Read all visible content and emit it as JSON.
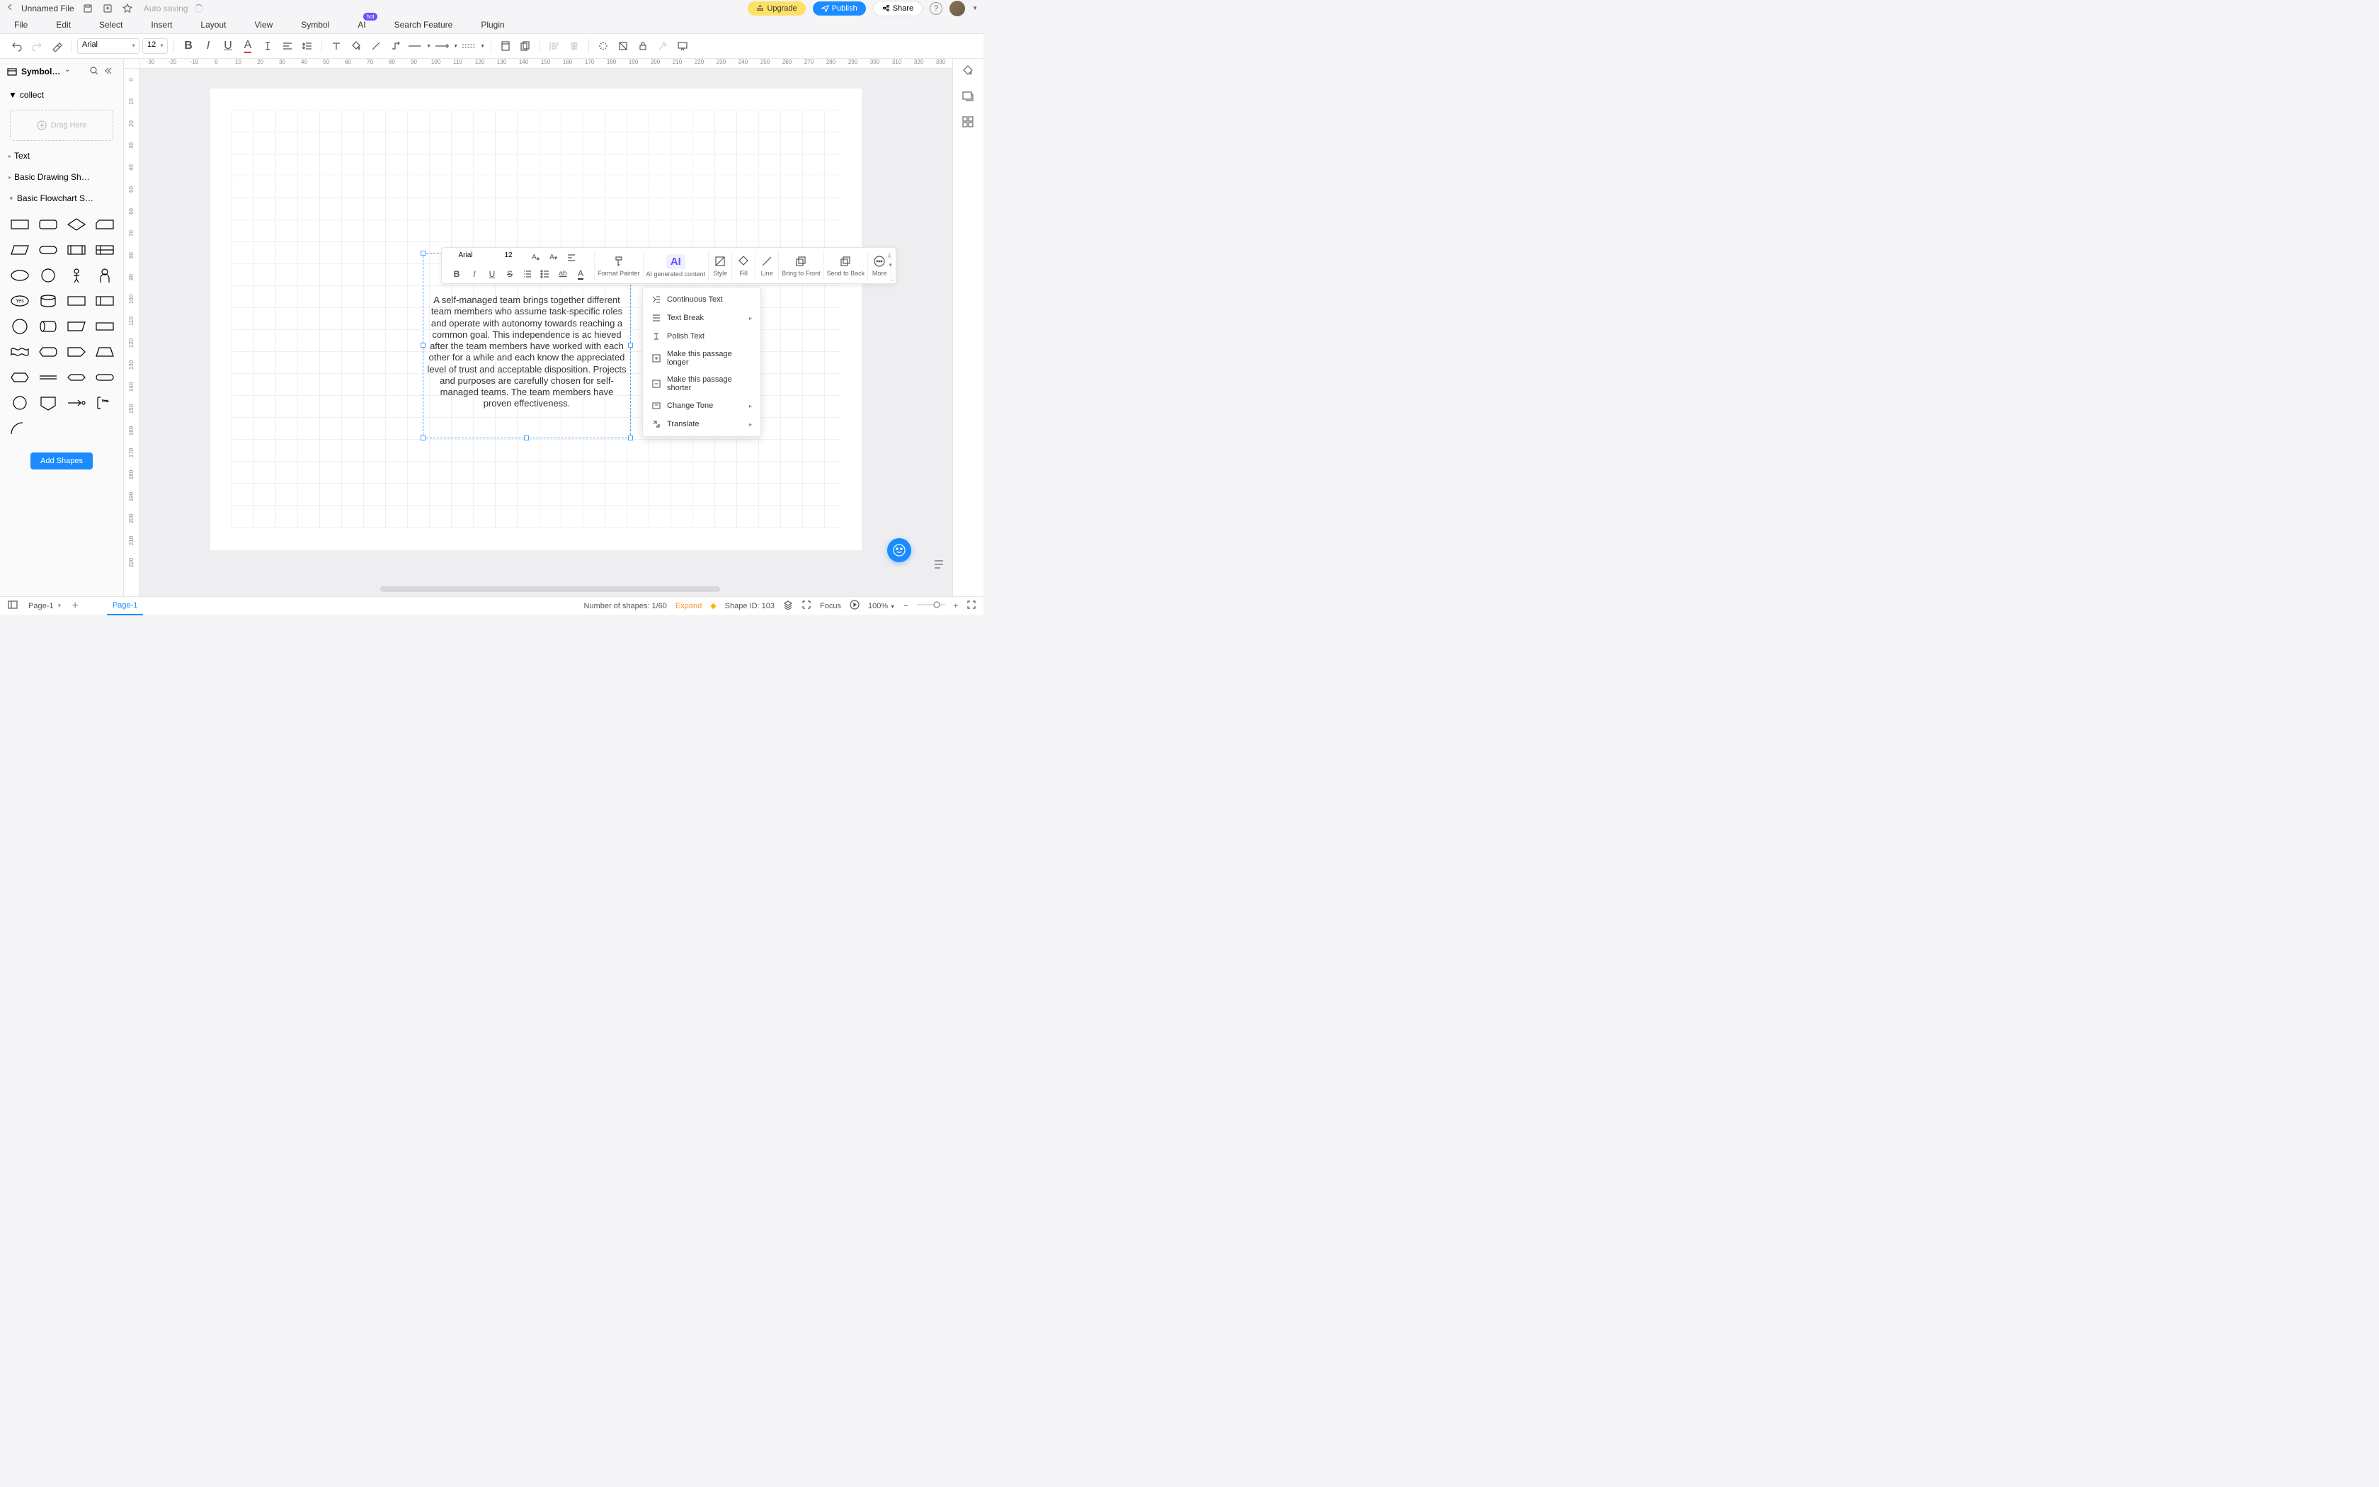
{
  "title": {
    "filename": "Unnamed File",
    "autosave": "Auto saving"
  },
  "topbar": {
    "upgrade": "Upgrade",
    "publish": "Publish",
    "share": "Share"
  },
  "menu": [
    "File",
    "Edit",
    "Select",
    "Insert",
    "Layout",
    "View",
    "Symbol",
    "AI",
    "Search Feature",
    "Plugin"
  ],
  "menu_hot_index": 7,
  "toolbar": {
    "font": "Arial",
    "size": "12"
  },
  "sidebar": {
    "title": "Symbol…",
    "collect": "collect",
    "drag": "Drag Here",
    "cats": [
      "Text",
      "Basic Drawing Sh…",
      "Basic Flowchart S…"
    ],
    "add": "Add Shapes",
    "yes": "Yes"
  },
  "ruler_h": [
    "-30",
    "-20",
    "-10",
    "0",
    "10",
    "20",
    "30",
    "40",
    "50",
    "60",
    "70",
    "80",
    "90",
    "100",
    "110",
    "120",
    "130",
    "140",
    "150",
    "160",
    "170",
    "180",
    "190",
    "200",
    "210",
    "220",
    "230",
    "240",
    "250",
    "260",
    "270",
    "280",
    "290",
    "300",
    "310",
    "320",
    "330"
  ],
  "ruler_v": [
    "0",
    "10",
    "20",
    "30",
    "40",
    "50",
    "60",
    "70",
    "80",
    "90",
    "100",
    "110",
    "120",
    "130",
    "140",
    "150",
    "160",
    "170",
    "180",
    "190",
    "200",
    "210",
    "220"
  ],
  "textbox": "A self-managed team brings together different team members who assume task-specific roles and operate with autonomy towards reaching a common goal. This independence is ac hieved after the team members have worked with each other for a while and each know the appreciated level of trust and acceptable disposition. Projects and purposes are carefully chosen for self-managed teams. The team members have proven effectiveness.",
  "ctx": {
    "font": "Arial",
    "size": "12",
    "format_painter": "Format Painter",
    "ai": "AI generated content",
    "style": "Style",
    "fill": "Fill",
    "line": "Line",
    "front": "Bring to Front",
    "back": "Send to Back",
    "more": "More"
  },
  "ai_menu": [
    "Continuous Text",
    "Text Break",
    "Polish Text",
    "Make this passage longer",
    "Make this passage shorter",
    "Change Tone",
    "Translate"
  ],
  "ai_menu_submenu": [
    false,
    true,
    false,
    false,
    false,
    true,
    true
  ],
  "bottom": {
    "page": "Page-1",
    "tab": "Page-1",
    "shapes": "Number of shapes: 1/60",
    "expand": "Expand",
    "shapeid": "Shape ID: 103",
    "focus": "Focus",
    "zoom": "100%"
  }
}
